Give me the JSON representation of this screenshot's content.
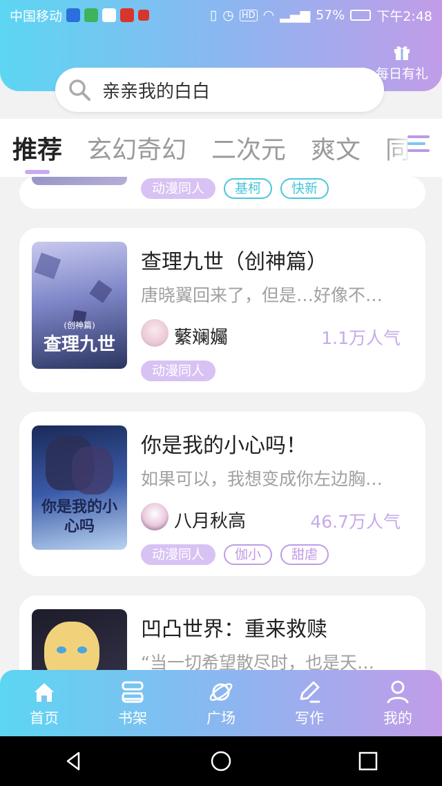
{
  "statusbar": {
    "carrier": "中国移动",
    "battery": "57%",
    "time": "下午2:48"
  },
  "header": {
    "gift_label": "每日有礼",
    "search_text": "亲亲我的白白"
  },
  "tabs": [
    "推荐",
    "玄幻奇幻",
    "二次元",
    "爽文",
    "同人"
  ],
  "books": [
    {
      "tags": [
        "动漫同人",
        "基柯",
        "快新"
      ]
    },
    {
      "title": "查理九世（创神篇）",
      "desc": "唐晓翼回来了，但是…好像不…",
      "author": "蘩斓孎",
      "popularity": "1.1万人气",
      "tags": [
        "动漫同人"
      ],
      "cover_text": "查理九世",
      "cover_sub": "(创神篇)"
    },
    {
      "title": "你是我的小心吗！",
      "desc": "如果可以，我想变成你左边胸…",
      "author": "八月秋高",
      "popularity": "46.7万人气",
      "tags": [
        "动漫同人",
        "伽小",
        "甜虐"
      ],
      "cover_text": "你是我的小心吗"
    },
    {
      "title": "凹凸世界：重来救赎",
      "desc": "“当一切希望散尽时，也是天…"
    }
  ],
  "nav": [
    "首页",
    "书架",
    "广场",
    "写作",
    "我的"
  ],
  "colors": {
    "accent_start": "#5cd6f2",
    "accent_end": "#c29ce8",
    "popularity": "#c6a9ea"
  }
}
